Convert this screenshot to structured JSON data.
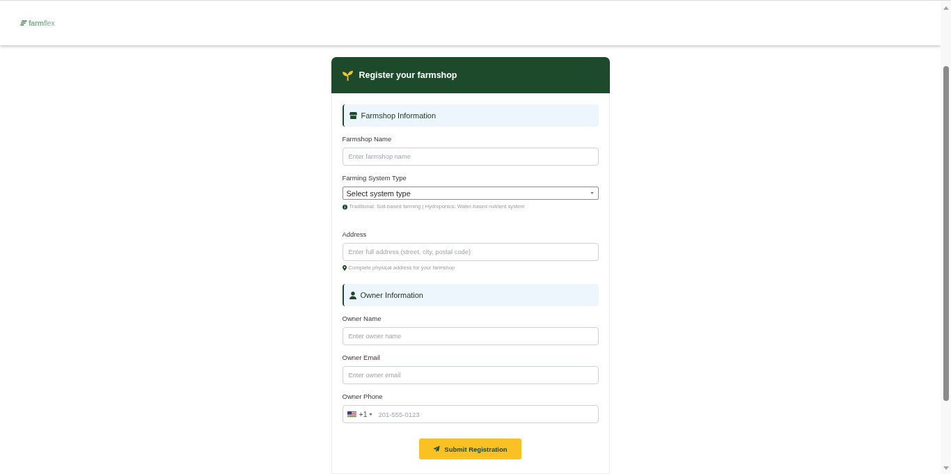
{
  "header": {
    "logo": "**farm**flex"
  },
  "form": {
    "title": "Register your farmshop",
    "sections": [
      {
        "kind": "shop",
        "title": "Farmshop Information",
        "fields": [
          {
            "kind": "text",
            "label": "Farmshop Name",
            "placeholder": "Enter farmshop name"
          },
          {
            "kind": "select",
            "label": "Farming System Type",
            "value": "Select system type",
            "hint": "Traditional: Soil-based farming | Hydroponics: Water-based nutrient system"
          },
          {
            "kind": "address",
            "label": "Address",
            "placeholder": "Enter full address (street, city, postal code)",
            "hint": "Complete physical address for your farmshop"
          }
        ]
      },
      {
        "kind": "owner",
        "title": "Owner Information",
        "fields": [
          {
            "kind": "text",
            "label": "Owner Name",
            "placeholder": "Enter owner name"
          },
          {
            "kind": "email",
            "label": "Owner Email",
            "placeholder": "Enter owner email"
          },
          {
            "kind": "phone",
            "label": "Owner Phone",
            "country_code": "+1",
            "placeholder": "201-555-0123"
          }
        ]
      }
    ],
    "submit": "Submit Registration"
  }
}
